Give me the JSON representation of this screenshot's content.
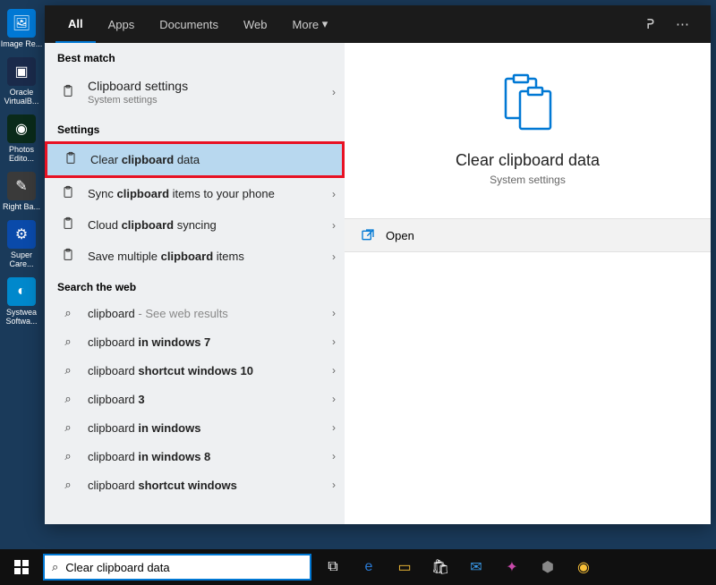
{
  "desktop_icons": [
    {
      "label": "Image Re..."
    },
    {
      "label": "Oracle VirtualB..."
    },
    {
      "label": "Photos Edito..."
    },
    {
      "label": "Right Ba..."
    },
    {
      "label": "Super Care..."
    },
    {
      "label": "Systwea Softwa..."
    }
  ],
  "tabs": {
    "all": "All",
    "apps": "Apps",
    "documents": "Documents",
    "web": "Web",
    "more": "More"
  },
  "sections": {
    "best": "Best match",
    "settings": "Settings",
    "web": "Search the web"
  },
  "best": {
    "title_a": "Clipboard",
    "title_b": " settings",
    "sub": "System settings"
  },
  "settings_rows": [
    {
      "a": "Clear ",
      "b": "clipboard",
      "c": " data"
    },
    {
      "a": "Sync ",
      "b": "clipboard",
      "c": " items to your phone"
    },
    {
      "a": "Cloud ",
      "b": "clipboard",
      "c": " syncing"
    },
    {
      "a": "Save multiple ",
      "b": "clipboard",
      "c": " items"
    }
  ],
  "web_rows": [
    {
      "a": "clipboard",
      "b": "",
      "c": "",
      "suf": " - See web results"
    },
    {
      "a": "clipboard ",
      "b": "in windows 7",
      "c": ""
    },
    {
      "a": "clipboard ",
      "b": "shortcut windows 10",
      "c": ""
    },
    {
      "a": "clipboard ",
      "b": "3",
      "c": ""
    },
    {
      "a": "clipboard ",
      "b": "in windows",
      "c": ""
    },
    {
      "a": "clipboard ",
      "b": "in windows 8",
      "c": ""
    },
    {
      "a": "clipboard ",
      "b": "shortcut windows",
      "c": ""
    }
  ],
  "detail": {
    "title": "Clear clipboard data",
    "sub": "System settings",
    "open": "Open"
  },
  "search_value": "Clear clipboard data",
  "chevron": "›",
  "accent": "#0078d4"
}
